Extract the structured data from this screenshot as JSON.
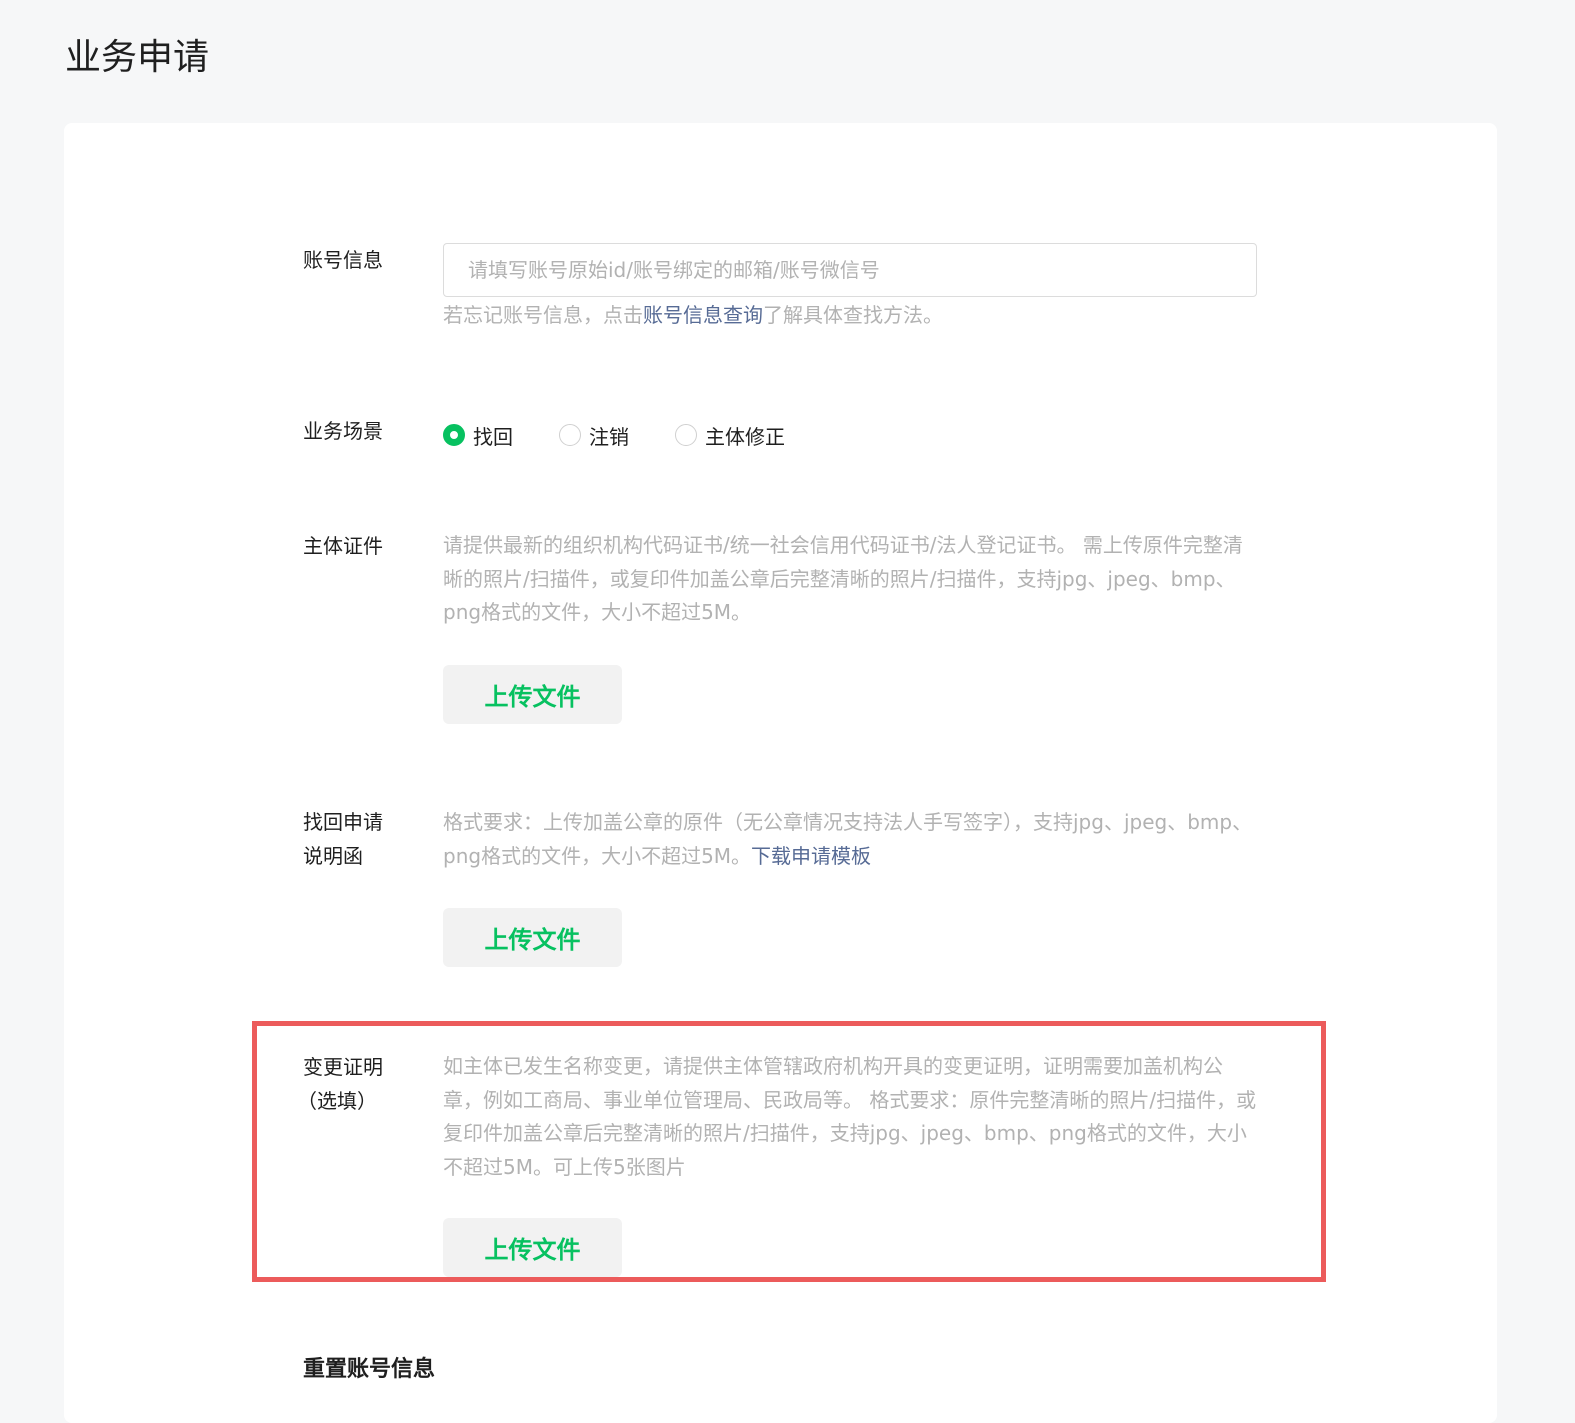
{
  "page": {
    "title": "业务申请"
  },
  "account": {
    "label": "账号信息",
    "placeholder": "请填写账号原始id/账号绑定的邮箱/账号微信号",
    "hint_prefix": "若忘记账号信息，点击",
    "hint_link": "账号信息查询",
    "hint_suffix": "了解具体查找方法。"
  },
  "scenario": {
    "label": "业务场景",
    "options": [
      {
        "label": "找回",
        "checked": true
      },
      {
        "label": "注销",
        "checked": false
      },
      {
        "label": "主体修正",
        "checked": false
      }
    ]
  },
  "certificate": {
    "label": "主体证件",
    "hint": "请提供最新的组织机构代码证书/统一社会信用代码证书/法人登记证书。 需上传原件完整清晰的照片/扫描件，或复印件加盖公章后完整清晰的照片/扫描件，支持jpg、jpeg、bmp、png格式的文件，大小不超过5M。",
    "upload_label": "上传文件"
  },
  "letter": {
    "label_line1": "找回申请",
    "label_line2": "说明函",
    "hint": "格式要求：上传加盖公章的原件（无公章情况支持法人手写签字），支持jpg、jpeg、bmp、png格式的文件，大小不超过5M。",
    "hint_link": "下载申请模板",
    "upload_label": "上传文件"
  },
  "change_proof": {
    "label_line1": "变更证明",
    "label_line2": "（选填）",
    "hint": "如主体已发生名称变更，请提供主体管辖政府机构开具的变更证明，证明需要加盖机构公章，例如工商局、事业单位管理局、民政局等。 格式要求：原件完整清晰的照片/扫描件，或复印件加盖公章后完整清晰的照片/扫描件，支持jpg、jpeg、bmp、png格式的文件，大小不超过5M。可上传5张图片",
    "upload_label": "上传文件"
  },
  "reset": {
    "title": "重置账号信息"
  },
  "colors": {
    "accent": "#07c160",
    "link": "#576b95",
    "highlight": "#ec5b5b",
    "hint": "#b2b2b2"
  }
}
